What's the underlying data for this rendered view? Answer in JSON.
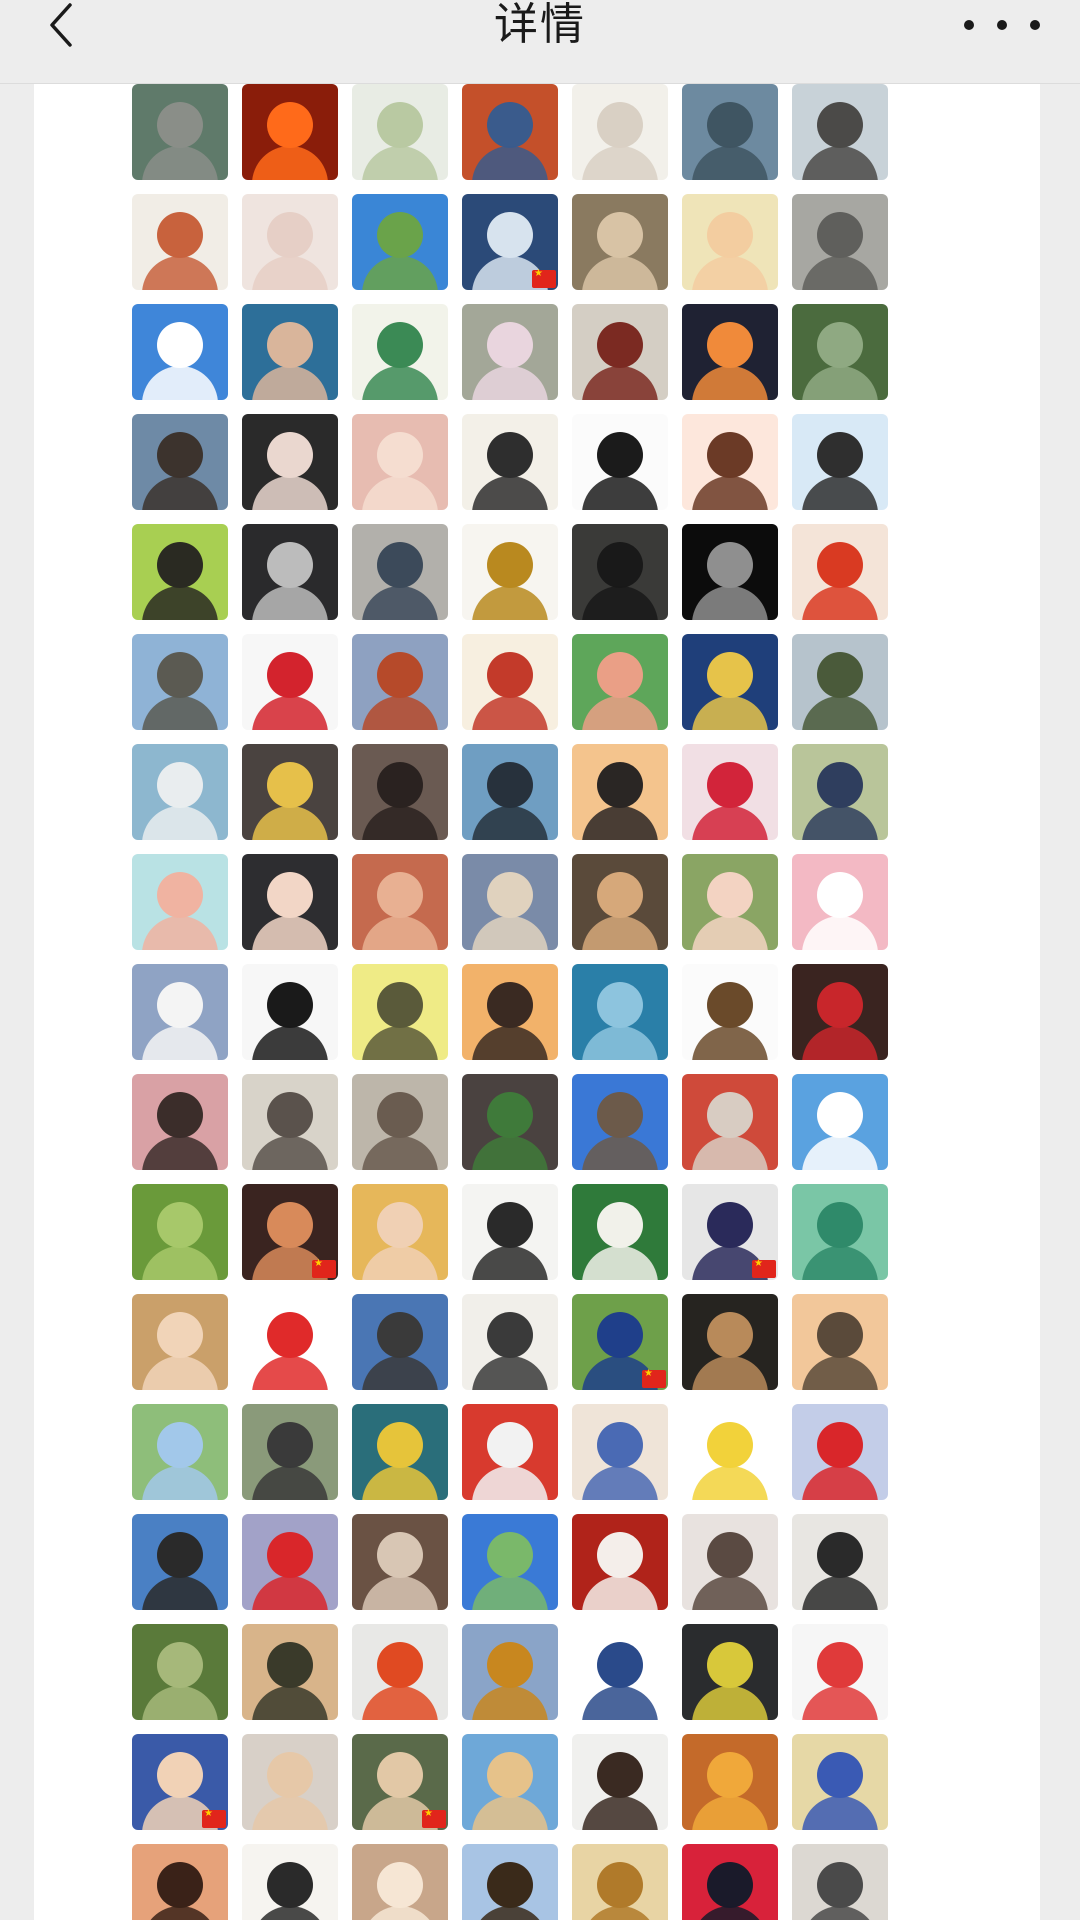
{
  "header": {
    "title": "详情",
    "back_icon": "chevron-left-icon",
    "more_icon": "more-dots-icon"
  },
  "members": [
    {
      "bg": "#5f7a6a",
      "fg": "#8a8e88",
      "flag": false
    },
    {
      "bg": "#8a1d0a",
      "fg": "#ff6a1a",
      "flag": false
    },
    {
      "bg": "#e8ece4",
      "fg": "#b9c9a2",
      "flag": false
    },
    {
      "bg": "#c4502a",
      "fg": "#3a5b8c",
      "flag": false
    },
    {
      "bg": "#f2f0ea",
      "fg": "#d9d0c4",
      "flag": false
    },
    {
      "bg": "#6d8aa0",
      "fg": "#3f5562",
      "flag": false
    },
    {
      "bg": "#c8d2d8",
      "fg": "#4b4a48",
      "flag": false
    },
    {
      "bg": "#f1ede6",
      "fg": "#c8623d",
      "flag": false
    },
    {
      "bg": "#efe4df",
      "fg": "#e6cfc6",
      "flag": false
    },
    {
      "bg": "#3a86d6",
      "fg": "#6aa34a",
      "flag": false
    },
    {
      "bg": "#2b4a78",
      "fg": "#d7e3ee",
      "flag": true
    },
    {
      "bg": "#8a7a60",
      "fg": "#d8c3a5",
      "flag": false
    },
    {
      "bg": "#efe4b8",
      "fg": "#f3cda0",
      "flag": false
    },
    {
      "bg": "#a7a7a2",
      "fg": "#5f5f5c",
      "flag": false
    },
    {
      "bg": "#3f86d9",
      "fg": "#ffffff",
      "flag": false
    },
    {
      "bg": "#2d6f99",
      "fg": "#d9b59b",
      "flag": false
    },
    {
      "bg": "#f2f3ea",
      "fg": "#3b8a55",
      "flag": false
    },
    {
      "bg": "#a3a798",
      "fg": "#e9d5de",
      "flag": false
    },
    {
      "bg": "#d4cec4",
      "fg": "#7b2a22",
      "flag": false
    },
    {
      "bg": "#1f2233",
      "fg": "#f08a3a",
      "flag": false
    },
    {
      "bg": "#4b6b3e",
      "fg": "#8fa982",
      "flag": false
    },
    {
      "bg": "#6e8aa6",
      "fg": "#3c332d",
      "flag": false
    },
    {
      "bg": "#2a2a2a",
      "fg": "#ead7cf",
      "flag": false
    },
    {
      "bg": "#e7bcb1",
      "fg": "#f5ddd0",
      "flag": false
    },
    {
      "bg": "#f3f0e8",
      "fg": "#2e2e2e",
      "flag": false
    },
    {
      "bg": "#fbfbfb",
      "fg": "#1b1b1b",
      "flag": false
    },
    {
      "bg": "#fde7dc",
      "fg": "#6b3a26",
      "flag": false
    },
    {
      "bg": "#d8e9f6",
      "fg": "#2f2f2f",
      "flag": false
    },
    {
      "bg": "#a8cf52",
      "fg": "#2a2a22",
      "flag": false
    },
    {
      "bg": "#2a2a2c",
      "fg": "#bcbcbc",
      "flag": false
    },
    {
      "bg": "#b2b0ab",
      "fg": "#3c4a5a",
      "flag": false
    },
    {
      "bg": "#f7f5f0",
      "fg": "#b9891f",
      "flag": false
    },
    {
      "bg": "#3a3a38",
      "fg": "#191919",
      "flag": false
    },
    {
      "bg": "#0c0c0c",
      "fg": "#8f8f8f",
      "flag": false
    },
    {
      "bg": "#f4e4d8",
      "fg": "#d93a22",
      "flag": false
    },
    {
      "bg": "#8fb3d6",
      "fg": "#5b5a52",
      "flag": false
    },
    {
      "bg": "#f7f7f7",
      "fg": "#d3232d",
      "flag": false
    },
    {
      "bg": "#8ea1c1",
      "fg": "#b64a2a",
      "flag": false
    },
    {
      "bg": "#f7efe0",
      "fg": "#c33a2a",
      "flag": false
    },
    {
      "bg": "#5ea65a",
      "fg": "#ea9f86",
      "flag": false
    },
    {
      "bg": "#1f3f7a",
      "fg": "#e6c34a",
      "flag": false
    },
    {
      "bg": "#b6c3cc",
      "fg": "#4a5a3a",
      "flag": false
    },
    {
      "bg": "#8db7cf",
      "fg": "#e9edef",
      "flag": false
    },
    {
      "bg": "#4a4340",
      "fg": "#e6c04a",
      "flag": false
    },
    {
      "bg": "#6a5a52",
      "fg": "#2a2220",
      "flag": false
    },
    {
      "bg": "#6f9ec2",
      "fg": "#27313c",
      "flag": false
    },
    {
      "bg": "#f4c48d",
      "fg": "#2a2624",
      "flag": false
    },
    {
      "bg": "#f1dfe4",
      "fg": "#d2243a",
      "flag": false
    },
    {
      "bg": "#b9c59a",
      "fg": "#2f3e5e",
      "flag": false
    },
    {
      "bg": "#b9e2e4",
      "fg": "#f0b3a1",
      "flag": false
    },
    {
      "bg": "#2d2d30",
      "fg": "#f2d6c6",
      "flag": false
    },
    {
      "bg": "#c56a4e",
      "fg": "#e8b092",
      "flag": false
    },
    {
      "bg": "#7a8ba8",
      "fg": "#e0d2be",
      "flag": false
    },
    {
      "bg": "#5a4a3a",
      "fg": "#d6a87a",
      "flag": false
    },
    {
      "bg": "#8aa564",
      "fg": "#f3d3c2",
      "flag": false
    },
    {
      "bg": "#f3b9c4",
      "fg": "#ffffff",
      "flag": false
    },
    {
      "bg": "#8fa3c4",
      "fg": "#f4f4f4",
      "flag": false
    },
    {
      "bg": "#f7f7f7",
      "fg": "#1a1a1a",
      "flag": false
    },
    {
      "bg": "#efeb86",
      "fg": "#5a5a3a",
      "flag": false
    },
    {
      "bg": "#f2b26a",
      "fg": "#3a2a22",
      "flag": false
    },
    {
      "bg": "#2a7fa8",
      "fg": "#8dc4de",
      "flag": false
    },
    {
      "bg": "#fbfbfb",
      "fg": "#6a4a2a",
      "flag": false
    },
    {
      "bg": "#3a2420",
      "fg": "#c8262b",
      "flag": false
    },
    {
      "bg": "#d9a1a5",
      "fg": "#3b2d2a",
      "flag": false
    },
    {
      "bg": "#d8d3c9",
      "fg": "#5a524c",
      "flag": false
    },
    {
      "bg": "#bdb6aa",
      "fg": "#6a5c50",
      "flag": false
    },
    {
      "bg": "#4a4240",
      "fg": "#3f7a3a",
      "flag": false
    },
    {
      "bg": "#3a78d6",
      "fg": "#6c5a4a",
      "flag": false
    },
    {
      "bg": "#cf4a3a",
      "fg": "#d8ccc2",
      "flag": false
    },
    {
      "bg": "#5aa2e0",
      "fg": "#ffffff",
      "flag": false
    },
    {
      "bg": "#6a9a3a",
      "fg": "#a7c86a",
      "flag": false
    },
    {
      "bg": "#3a2420",
      "fg": "#d88a5a",
      "flag": true
    },
    {
      "bg": "#e6b75a",
      "fg": "#f0d0b4",
      "flag": false
    },
    {
      "bg": "#f4f4f2",
      "fg": "#2a2a2a",
      "flag": false
    },
    {
      "bg": "#2f7a3a",
      "fg": "#f1f1ea",
      "flag": false
    },
    {
      "bg": "#e6e6e6",
      "fg": "#2a2a5a",
      "flag": true
    },
    {
      "bg": "#7ac6a6",
      "fg": "#2f8a6a",
      "flag": false
    },
    {
      "bg": "#caa06a",
      "fg": "#f1d4b8",
      "flag": false
    },
    {
      "bg": "#ffffff",
      "fg": "#e02a2a",
      "flag": false
    },
    {
      "bg": "#4a76b4",
      "fg": "#3a3a3a",
      "flag": false
    },
    {
      "bg": "#f1efea",
      "fg": "#3a3a3a",
      "flag": false
    },
    {
      "bg": "#6ea04a",
      "fg": "#1f3f8a",
      "flag": true
    },
    {
      "bg": "#262420",
      "fg": "#b88a5a",
      "flag": false
    },
    {
      "bg": "#f2c79a",
      "fg": "#5a4a3a",
      "flag": false
    },
    {
      "bg": "#8ebe7a",
      "fg": "#a2c8ea",
      "flag": false
    },
    {
      "bg": "#8a9a7a",
      "fg": "#3a3a3a",
      "flag": false
    },
    {
      "bg": "#2a6e7a",
      "fg": "#e6c43a",
      "flag": false
    },
    {
      "bg": "#d83a2e",
      "fg": "#f2f2f2",
      "flag": false
    },
    {
      "bg": "#efe4d8",
      "fg": "#4a6ab4",
      "flag": false
    },
    {
      "bg": "#ffffff",
      "fg": "#f2d23a",
      "flag": false
    },
    {
      "bg": "#c3cde8",
      "fg": "#d9262a",
      "flag": false
    },
    {
      "bg": "#4a80c4",
      "fg": "#2a2a2a",
      "flag": false
    },
    {
      "bg": "#a2a2c8",
      "fg": "#d9262a",
      "flag": false
    },
    {
      "bg": "#6a5244",
      "fg": "#d8c6b4",
      "flag": false
    },
    {
      "bg": "#3a7ad6",
      "fg": "#7ab86a",
      "flag": false
    },
    {
      "bg": "#b0231a",
      "fg": "#f4eeea",
      "flag": false
    },
    {
      "bg": "#e8e2df",
      "fg": "#5a4a42",
      "flag": false
    },
    {
      "bg": "#e8e6e2",
      "fg": "#2a2a2a",
      "flag": false
    },
    {
      "bg": "#5a7a3a",
      "fg": "#a6b87a",
      "flag": false
    },
    {
      "bg": "#d8b48a",
      "fg": "#3a3a2a",
      "flag": false
    },
    {
      "bg": "#e8e8e6",
      "fg": "#e04a22",
      "flag": false
    },
    {
      "bg": "#8aa4c8",
      "fg": "#c8871f",
      "flag": false
    },
    {
      "bg": "#ffffff",
      "fg": "#2a4a8a",
      "flag": false
    },
    {
      "bg": "#2a2c2e",
      "fg": "#d8c83a",
      "flag": false
    },
    {
      "bg": "#f6f6f6",
      "fg": "#e03a3a",
      "flag": false
    },
    {
      "bg": "#3a5aa8",
      "fg": "#f1d2b6",
      "flag": true
    },
    {
      "bg": "#d8d0c8",
      "fg": "#e6c8a8",
      "flag": false
    },
    {
      "bg": "#5a6a4a",
      "fg": "#e2c8a6",
      "flag": true
    },
    {
      "bg": "#6ea8d8",
      "fg": "#e6c28a",
      "flag": false
    },
    {
      "bg": "#f0f0ee",
      "fg": "#3a2a22",
      "flag": false
    },
    {
      "bg": "#c46a2a",
      "fg": "#f0a83a",
      "flag": false
    },
    {
      "bg": "#e6d8a6",
      "fg": "#3a5ab4",
      "flag": false
    },
    {
      "bg": "#e6a27a",
      "fg": "#3a2218",
      "flag": false
    },
    {
      "bg": "#f6f4f0",
      "fg": "#2a2a2a",
      "flag": false
    },
    {
      "bg": "#c8a68a",
      "fg": "#f6e6d4",
      "flag": false
    },
    {
      "bg": "#a8c4e4",
      "fg": "#3a2a1a",
      "flag": false
    },
    {
      "bg": "#e8d4a4",
      "fg": "#b07a2a",
      "flag": false
    },
    {
      "bg": "#d8223a",
      "fg": "#1a1a2a",
      "flag": false
    },
    {
      "bg": "#dcd8d2",
      "fg": "#4a4a4a",
      "flag": false
    }
  ]
}
